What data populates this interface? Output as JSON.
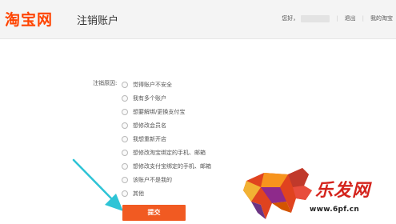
{
  "header": {
    "logo": "淘宝网",
    "page_title": "注销账户",
    "greeting": "您好，",
    "logout": "退出",
    "my_taobao": "我的淘宝"
  },
  "form": {
    "label": "注销原因:",
    "options": [
      "觉得账户不安全",
      "我有多个账户",
      "想要解绑/更换支付宝",
      "想修改会员名",
      "我想重新开店",
      "想修改淘宝绑定的手机、邮箱",
      "想修改支付宝绑定的手机、邮箱",
      "该账户不是我的",
      "其他"
    ],
    "submit": "提交"
  },
  "watermark": {
    "brand": "乐发网",
    "url": "www.6pf.cn"
  },
  "colors": {
    "brand_orange": "#ff4400",
    "submit_bg": "#f15a22",
    "arrow": "#2ec4d6",
    "watermark_red": "#d4231c"
  }
}
